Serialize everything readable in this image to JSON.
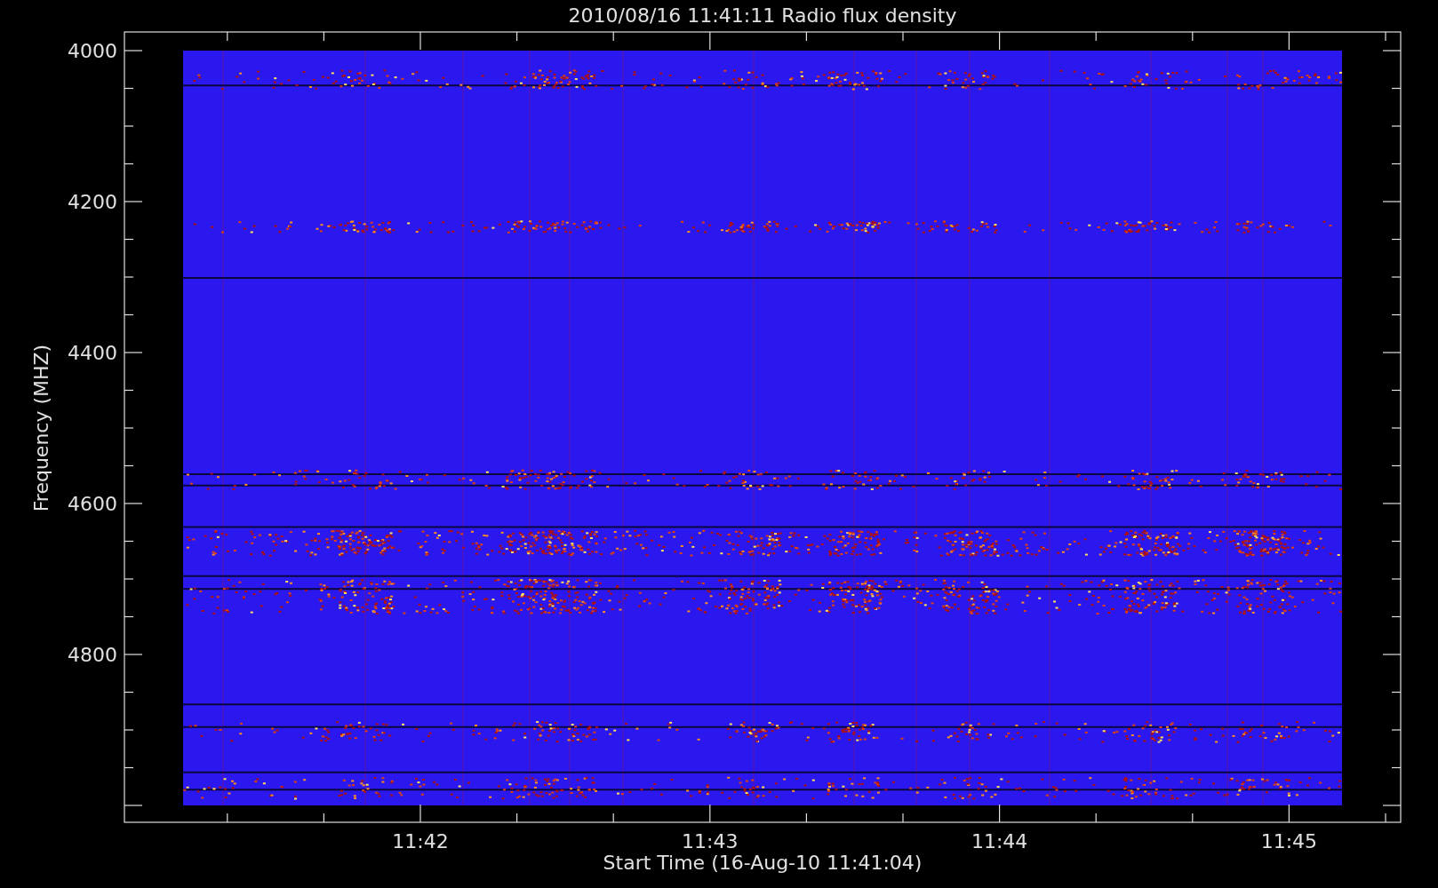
{
  "title": "2010/08/16 11:41:11 Radio flux density",
  "y_axis": {
    "label": "Frequency (MHZ)",
    "ticks": [
      "4000",
      "4200",
      "4400",
      "4600",
      "4800"
    ]
  },
  "x_axis": {
    "label": "Start Time (16-Aug-10 11:41:04)",
    "ticks": [
      "11:42",
      "11:43",
      "11:44",
      "11:45"
    ]
  }
}
